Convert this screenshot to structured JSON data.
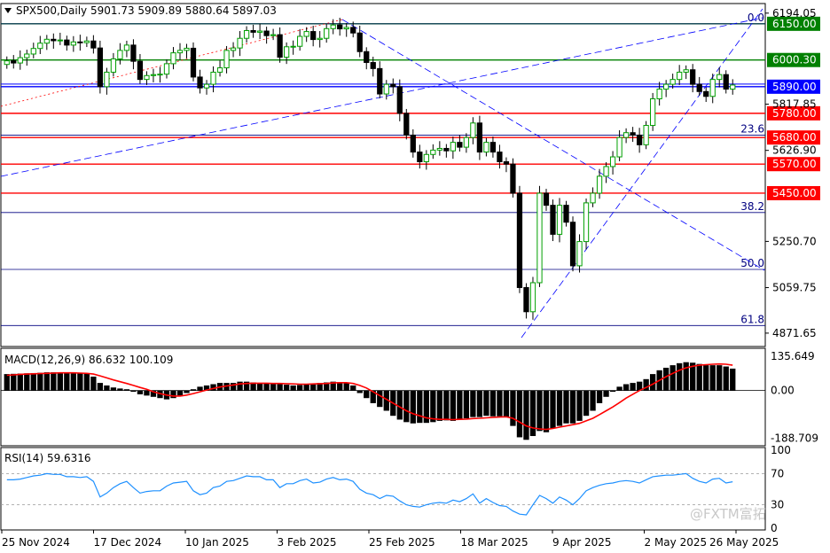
{
  "header": {
    "symbol_line": "SPX500,Daily  5901.73 5909.89 5880.64 5897.03"
  },
  "watermark": "@FXTM富拓",
  "colors": {
    "bull": "#ffffff",
    "bear": "#000000",
    "wick": "#000000",
    "bull_border": "#00a000",
    "support": "#ff0000",
    "blue": "#0000ff",
    "green_line": "#008000",
    "macd_line": "#ff0000",
    "rsi_line": "#1e90ff",
    "fib": "#000080",
    "label_bg_red": "#ff0000",
    "label_bg_green": "#008000",
    "label_bg_blue": "#0000ff"
  },
  "chart_data": [
    {
      "type": "candlestick",
      "title": "SPX500,Daily",
      "ohlc_readout": {
        "open": 5901.73,
        "high": 5909.89,
        "low": 5880.64,
        "close": 5897.03
      },
      "x_tick_labels": [
        "25 Nov 2024",
        "17 Dec 2024",
        "10 Jan 2025",
        "3 Feb 2025",
        "25 Feb 2025",
        "18 Mar 2025",
        "9 Apr 2025",
        "2 May 2025",
        "26 May 2025"
      ],
      "y_tick_labels": [
        "6194.05",
        "5817.85",
        "5626.90",
        "5250.70",
        "5059.75",
        "4871.65"
      ],
      "ylim": [
        4820,
        6230
      ],
      "horizontal_levels": [
        {
          "label": "6150.00",
          "value": 6150,
          "color": "green"
        },
        {
          "label": "6000.30",
          "value": 6000.3,
          "color": "green"
        },
        {
          "label": "5890.00",
          "value": 5890,
          "color": "blue"
        },
        {
          "label": "5780.00",
          "value": 5780,
          "color": "red"
        },
        {
          "label": "5680.00",
          "value": 5680,
          "color": "red"
        },
        {
          "label": "5570.00",
          "value": 5570,
          "color": "red"
        },
        {
          "label": "5450.00",
          "value": 5450,
          "color": "red"
        }
      ],
      "fibonacci": [
        {
          "label": "0.0",
          "value": 6150
        },
        {
          "label": "23.6",
          "value": 5690
        },
        {
          "label": "38.2",
          "value": 5370
        },
        {
          "label": "50.0",
          "value": 5135
        },
        {
          "label": "61.8",
          "value": 4903
        }
      ],
      "closes": [
        5997,
        5988,
        6010,
        6025,
        6048,
        6070,
        6086,
        6080,
        6083,
        6062,
        6075,
        6072,
        6079,
        6050,
        5890,
        5950,
        6005,
        6040,
        6062,
        5995,
        5920,
        5936,
        5940,
        5942,
        5985,
        6030,
        6040,
        6049,
        5930,
        5885,
        5900,
        5950,
        5968,
        6040,
        6050,
        6090,
        6122,
        6115,
        6120,
        6101,
        6105,
        6012,
        6055,
        6057,
        6098,
        6118,
        6085,
        6090,
        6130,
        6145,
        6129,
        6135,
        6112,
        6035,
        5990,
        5965,
        5860,
        5900,
        5890,
        5780,
        5690,
        5620,
        5580,
        5610,
        5628,
        5635,
        5625,
        5660,
        5640,
        5680,
        5740,
        5620,
        5660,
        5620,
        5580,
        5570,
        5450,
        5060,
        4960,
        5080,
        5450,
        5400,
        5280,
        5400,
        5330,
        5150,
        5250,
        5410,
        5450,
        5520,
        5560,
        5600,
        5680,
        5700,
        5690,
        5650,
        5730,
        5840,
        5880,
        5900,
        5920,
        5950,
        5960,
        5900,
        5870,
        5850,
        5920,
        5940,
        5880,
        5897
      ]
    },
    {
      "type": "line",
      "title": "MACD(12,26,9) 86.632 100.109",
      "y_tick_labels": [
        "135.649",
        "0.00",
        "-188.709"
      ],
      "ylim": [
        -215,
        160
      ],
      "series": [
        {
          "name": "MACD",
          "type": "bar",
          "values": [
            65,
            66,
            67,
            68,
            69,
            70,
            72,
            72,
            72,
            70,
            70,
            68,
            66,
            55,
            30,
            20,
            12,
            8,
            5,
            -5,
            -15,
            -20,
            -25,
            -30,
            -35,
            -30,
            -20,
            -10,
            5,
            15,
            20,
            25,
            30,
            30,
            30,
            35,
            35,
            32,
            28,
            27,
            28,
            25,
            23,
            20,
            22,
            25,
            28,
            30,
            32,
            35,
            33,
            32,
            20,
            -10,
            -30,
            -50,
            -65,
            -80,
            -100,
            -115,
            -125,
            -130,
            -128,
            -128,
            -125,
            -120,
            -118,
            -120,
            -115,
            -110,
            -105,
            -105,
            -100,
            -102,
            -102,
            -105,
            -140,
            -185,
            -195,
            -180,
            -160,
            -165,
            -150,
            -140,
            -130,
            -130,
            -120,
            -100,
            -80,
            -50,
            -25,
            -5,
            15,
            25,
            30,
            35,
            45,
            65,
            80,
            90,
            100,
            108,
            112,
            110,
            105,
            100,
            100,
            100,
            95,
            86.6
          ]
        },
        {
          "name": "Signal",
          "values": [
            60,
            62,
            64,
            65,
            66,
            67,
            68,
            69,
            70,
            70,
            70,
            69,
            68,
            65,
            58,
            50,
            42,
            35,
            28,
            20,
            12,
            5,
            -5,
            -12,
            -18,
            -22,
            -22,
            -18,
            -12,
            -5,
            2,
            8,
            14,
            18,
            22,
            26,
            28,
            29,
            29,
            29,
            28,
            28,
            27,
            26,
            25,
            25,
            26,
            27,
            28,
            30,
            31,
            31,
            28,
            20,
            10,
            -5,
            -20,
            -35,
            -50,
            -65,
            -80,
            -92,
            -100,
            -108,
            -112,
            -114,
            -114,
            -115,
            -114,
            -113,
            -111,
            -110,
            -108,
            -106,
            -105,
            -104,
            -110,
            -125,
            -140,
            -148,
            -152,
            -154,
            -150,
            -145,
            -140,
            -135,
            -130,
            -120,
            -110,
            -95,
            -80,
            -65,
            -48,
            -30,
            -15,
            0,
            12,
            25,
            40,
            55,
            68,
            80,
            90,
            96,
            100,
            102,
            104,
            105,
            104,
            100.1
          ]
        }
      ]
    },
    {
      "type": "line",
      "title": "RSI(14) 59.6316",
      "y_tick_labels": [
        "100",
        "70",
        "30",
        "0"
      ],
      "ylim": [
        0,
        100
      ],
      "levels": [
        70,
        30
      ],
      "series": [
        {
          "name": "RSI",
          "values": [
            62,
            62,
            63,
            65,
            67,
            68,
            70,
            69,
            69,
            66,
            66,
            65,
            66,
            60,
            40,
            45,
            52,
            57,
            60,
            52,
            45,
            47,
            48,
            48,
            54,
            58,
            59,
            60,
            48,
            43,
            45,
            52,
            54,
            60,
            61,
            64,
            67,
            66,
            66,
            62,
            62,
            52,
            57,
            57,
            61,
            63,
            58,
            59,
            63,
            65,
            62,
            63,
            60,
            50,
            45,
            43,
            38,
            42,
            41,
            35,
            30,
            28,
            27,
            30,
            32,
            33,
            32,
            36,
            34,
            38,
            44,
            32,
            38,
            33,
            29,
            28,
            22,
            18,
            17,
            30,
            42,
            38,
            32,
            40,
            36,
            30,
            38,
            48,
            52,
            55,
            57,
            58,
            60,
            61,
            60,
            58,
            62,
            66,
            67,
            68,
            68,
            69,
            70,
            64,
            60,
            58,
            63,
            64,
            58,
            59.6
          ]
        }
      ]
    }
  ]
}
